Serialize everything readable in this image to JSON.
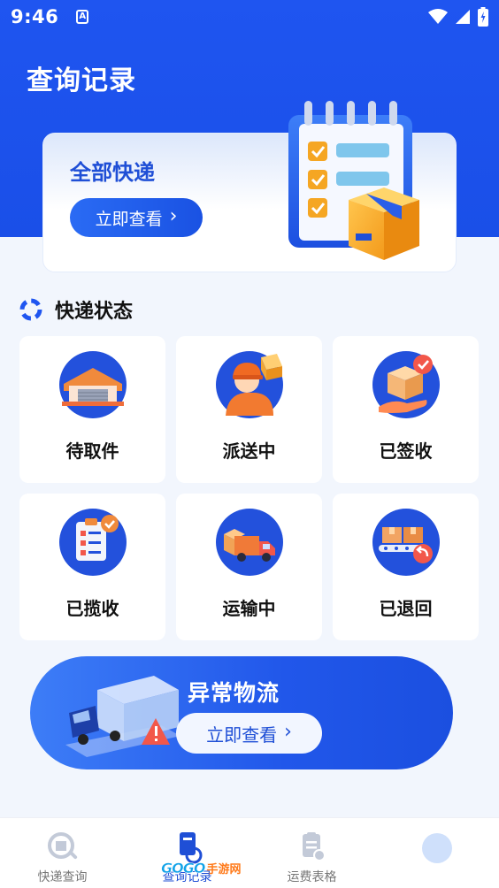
{
  "status_bar": {
    "time": "9:46",
    "notification_glyph": "A",
    "icons": [
      "wifi-icon",
      "signal-icon",
      "battery-icon"
    ]
  },
  "header": {
    "title": "查询记录"
  },
  "all_card": {
    "title": "全部快递",
    "button_label": "立即查看"
  },
  "status_section": {
    "title": "快递状态",
    "items": [
      {
        "label": "待取件",
        "icon": "warehouse-icon"
      },
      {
        "label": "派送中",
        "icon": "courier-icon"
      },
      {
        "label": "已签收",
        "icon": "package-received-icon"
      },
      {
        "label": "已揽收",
        "icon": "clipboard-check-icon"
      },
      {
        "label": "运输中",
        "icon": "truck-icon"
      },
      {
        "label": "已退回",
        "icon": "return-conveyor-icon"
      }
    ]
  },
  "abnormal_card": {
    "title": "异常物流",
    "button_label": "立即查看"
  },
  "tabbar": {
    "tabs": [
      {
        "label": "快递查询",
        "icon": "search-package-icon",
        "active": false
      },
      {
        "label": "查询记录",
        "icon": "record-icon",
        "active": true
      },
      {
        "label": "运费表格",
        "icon": "freight-sheet-icon",
        "active": false
      },
      {
        "label": "",
        "icon": "profile-icon",
        "active": false
      }
    ]
  },
  "watermark": {
    "brand": "GOGO",
    "site": "手游网"
  },
  "colors": {
    "primary": "#1f55f0",
    "accent_orange": "#f5a623",
    "background": "#f2f6fd"
  }
}
